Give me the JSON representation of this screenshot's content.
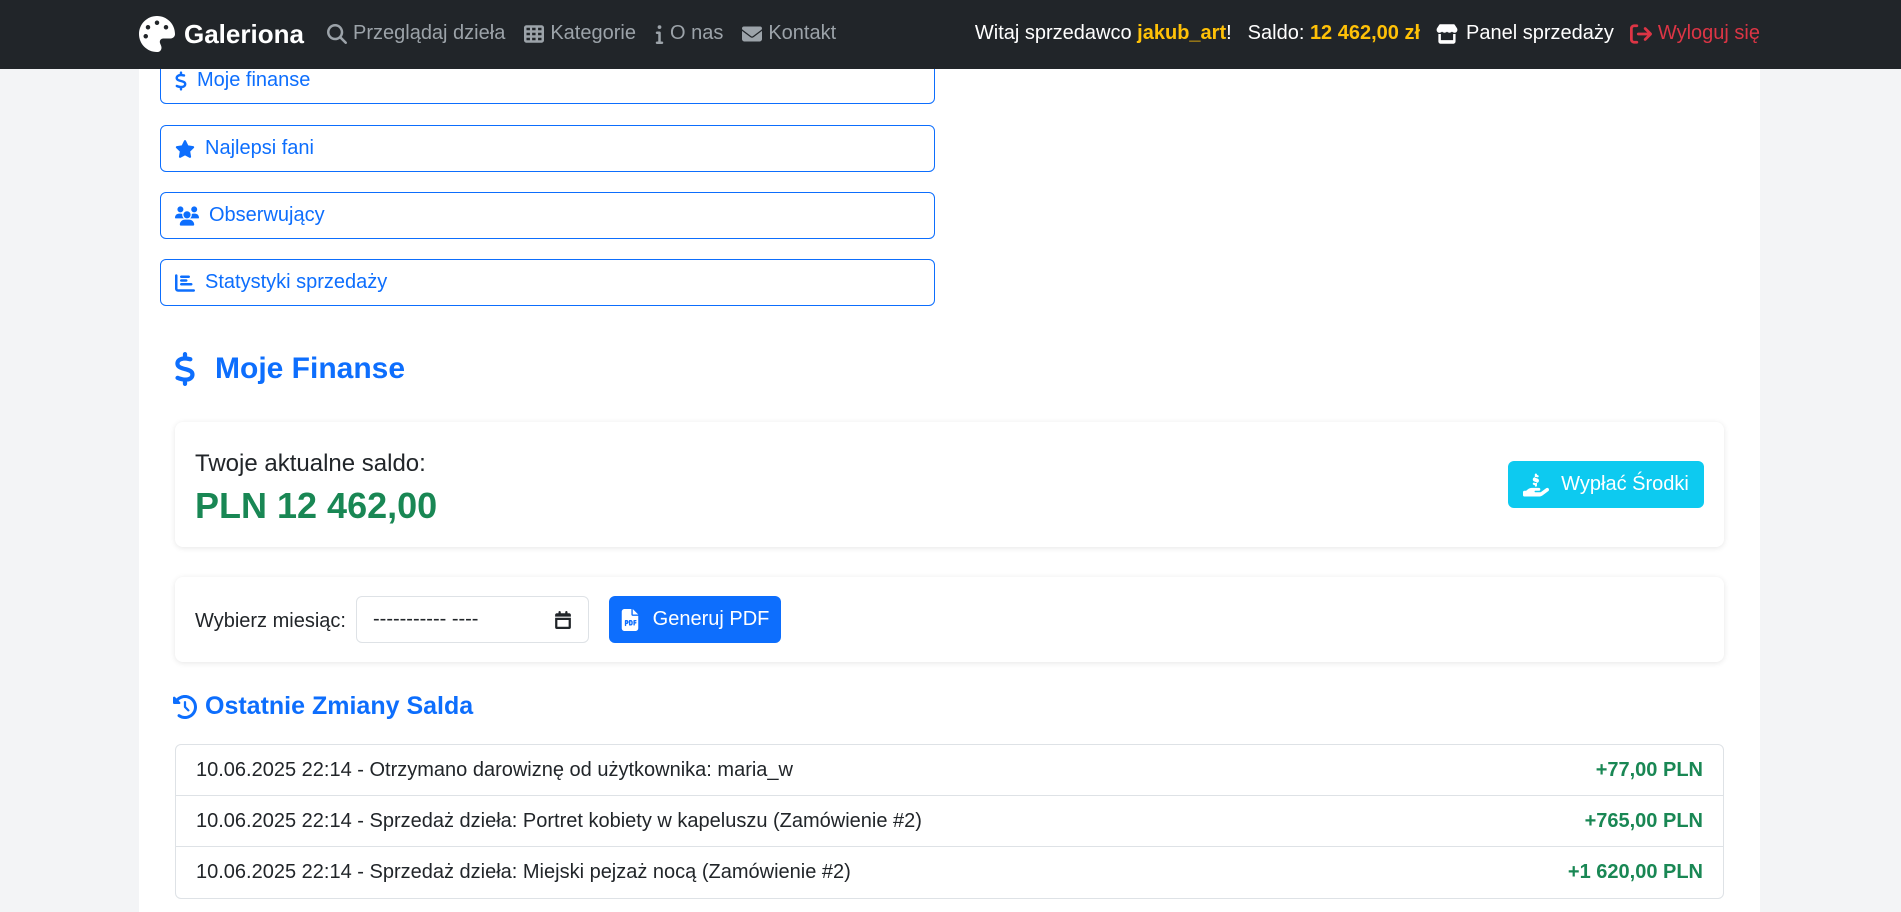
{
  "navbar": {
    "brand": "Galeriona",
    "links": [
      {
        "label": "Przeglądaj dzieła",
        "icon": "search-icon"
      },
      {
        "label": "Kategorie",
        "icon": "grid-icon"
      },
      {
        "label": "O nas",
        "icon": "info-icon"
      },
      {
        "label": "Kontakt",
        "icon": "envelope-icon"
      }
    ],
    "greeting_prefix": "Witaj sprzedawco ",
    "username": "jakub_art",
    "greeting_suffix": "!",
    "balance_label": "Saldo: ",
    "balance_value": "12 462,00 zł",
    "panel_label": "Panel sprzedaży",
    "logout_label": "Wyloguj się"
  },
  "menu": [
    {
      "label": "Moje finanse",
      "icon": "dollar-icon"
    },
    {
      "label": "Najlepsi fani",
      "icon": "star-icon"
    },
    {
      "label": "Obserwujący",
      "icon": "users-icon"
    },
    {
      "label": "Statystyki sprzedaży",
      "icon": "bar-chart-icon"
    }
  ],
  "finance": {
    "title": "Moje Finanse",
    "balance_label": "Twoje aktualne saldo:",
    "balance_value": "PLN 12 462,00",
    "withdraw_label": "Wypłać Środki"
  },
  "report": {
    "month_label": "Wybierz miesiąc:",
    "month_value": "----------- ----",
    "pdf_label": "Generuj PDF"
  },
  "history": {
    "title": "Ostatnie Zmiany Salda",
    "rows": [
      {
        "text": "10.06.2025 22:14 - Otrzymano darowiznę od użytkownika: maria_w",
        "amount": "+77,00 PLN"
      },
      {
        "text": "10.06.2025 22:14 - Sprzedaż dzieła: Portret kobiety w kapeluszu (Zamówienie #2)",
        "amount": "+765,00 PLN"
      },
      {
        "text": "10.06.2025 22:14 - Sprzedaż dzieła: Miejski pejzaż nocą (Zamówienie #2)",
        "amount": "+1 620,00 PLN"
      }
    ]
  },
  "colors": {
    "primary": "#0d6efd",
    "success": "#198754",
    "info": "#0dcaf0",
    "warning": "#ffc107",
    "danger": "#dc3545",
    "navbar_bg": "#212529"
  }
}
